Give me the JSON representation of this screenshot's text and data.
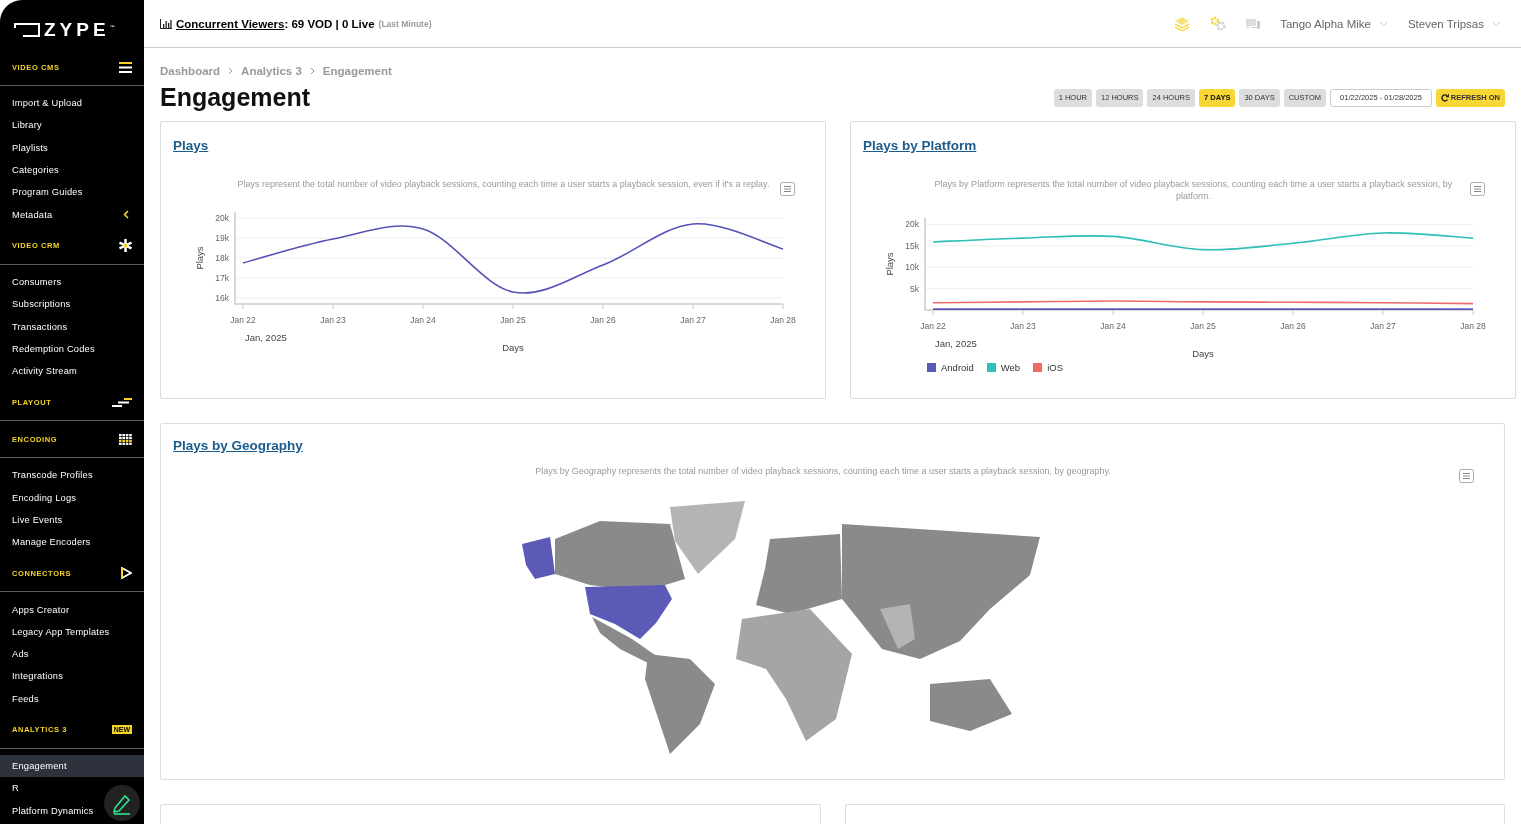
{
  "sidebar": {
    "logo": "ZYPE$^{™}$",
    "sections": [
      {
        "title": "VIDEO CMS",
        "kind": "menu",
        "items": [
          {
            "label": "Import & Upload",
            "selected": false
          },
          {
            "label": "Library",
            "selected": false
          },
          {
            "label": "Playlists",
            "selected": false
          },
          {
            "label": "Categories",
            "selected": false
          },
          {
            "label": "Program Guides",
            "selected": false
          },
          {
            "label": "Metadata",
            "selected": false,
            "has_submenu": true
          }
        ]
      },
      {
        "title": "VIDEO CRM",
        "kind": "asterisk",
        "items": [
          {
            "label": "Consumers",
            "selected": false
          },
          {
            "label": "Subscriptions",
            "selected": false
          },
          {
            "label": "Transactions",
            "selected": false
          },
          {
            "label": "Redemption Codes",
            "selected": false
          },
          {
            "label": "Activity Stream",
            "selected": false
          }
        ]
      },
      {
        "title": "PLAYOUT",
        "kind": "steps"
      },
      {
        "title": "ENCODING",
        "kind": "grid",
        "items": [
          {
            "label": "Transcode Profiles",
            "selected": false
          },
          {
            "label": "Encoding Logs",
            "selected": false
          },
          {
            "label": "Live Events",
            "selected": false
          },
          {
            "label": "Manage Encoders",
            "selected": false
          }
        ]
      },
      {
        "title": "CONNECTORS",
        "kind": "play",
        "items": [
          {
            "label": "Apps Creator",
            "selected": false
          },
          {
            "label": "Legacy App Templates",
            "selected": false
          },
          {
            "label": "Ads",
            "selected": false
          },
          {
            "label": "Integrations",
            "selected": false
          },
          {
            "label": "Feeds",
            "selected": false
          }
        ]
      },
      {
        "title": "ANALYTICS 3",
        "kind": "badge",
        "badge": "NEW",
        "items": [
          {
            "label": "Engagement",
            "selected": true
          },
          {
            "label": "R",
            "selected": false
          },
          {
            "label": "Platform Dynamics",
            "selected": false
          }
        ]
      }
    ]
  },
  "topbar": {
    "viewers_label": "Concurrent Viewers",
    "viewers_value": ": 69 VOD | 0 Live",
    "viewers_note": "(Last Minute)",
    "users": [
      "Tango Alpha Mike",
      "Steven Tripsas"
    ]
  },
  "breadcrumb": [
    "Dashboard",
    "Analytics 3",
    "Engagement"
  ],
  "title": "Engagement",
  "ranges": [
    {
      "label": "1 HOUR",
      "selected": false
    },
    {
      "label": "12 HOURS",
      "selected": false
    },
    {
      "label": "24 HOURS",
      "selected": false
    },
    {
      "label": "7 DAYS",
      "selected": true
    },
    {
      "label": "30 DAYS",
      "selected": false
    },
    {
      "label": "CUSTOM",
      "selected": false
    }
  ],
  "date_range": "01/22/2025 - 01/28/2025",
  "refresh": "REFRESH ON",
  "plays": {
    "title": "Plays",
    "description": "Plays represent the total number of video playback sessions, counting each time a user starts a playback session, even if it's a replay.",
    "period": "Jan, 2025",
    "chart_data": {
      "type": "line",
      "xlabel": "Days",
      "ylabel": "Plays",
      "categories": [
        "Jan 22",
        "Jan 23",
        "Jan 24",
        "Jan 25",
        "Jan 26",
        "Jan 27",
        "Jan 28"
      ],
      "ylim": [
        15700,
        20300
      ],
      "yticks": [
        {
          "value": 16000,
          "label": "16k"
        },
        {
          "value": 17000,
          "label": "17k"
        },
        {
          "value": 18000,
          "label": "18k"
        },
        {
          "value": 19000,
          "label": "19k"
        },
        {
          "value": 20000,
          "label": "20k"
        }
      ],
      "grid": true,
      "series": [
        {
          "color": "#5452b8",
          "values": [
            17750,
            18950,
            19450,
            16300,
            17650,
            19700,
            18450
          ]
        }
      ]
    }
  },
  "platform": {
    "title": "Plays by Platform",
    "description": "Plays by Platform represents the total number of video playback sessions, counting each time a user starts a playback session, by platform.",
    "period": "Jan, 2025",
    "chart_data": {
      "type": "line",
      "xlabel": "Days",
      "ylabel": "Plays",
      "categories": [
        "Jan 22",
        "Jan 23",
        "Jan 24",
        "Jan 25",
        "Jan 26",
        "Jan 27",
        "Jan 28"
      ],
      "ylim": [
        0,
        21500
      ],
      "yticks": [
        {
          "value": 5000,
          "label": "5k"
        },
        {
          "value": 10000,
          "label": "10k"
        },
        {
          "value": 15000,
          "label": "15k"
        },
        {
          "value": 20000,
          "label": "20k"
        }
      ],
      "grid": true,
      "legend": true,
      "series": [
        {
          "name": "Android",
          "color": "#5b5bb7",
          "values": [
            200,
            200,
            200,
            200,
            200,
            200,
            200
          ]
        },
        {
          "name": "Web",
          "color": "#2fbfb6",
          "values": [
            15900,
            16800,
            17200,
            14100,
            15600,
            18000,
            16800
          ]
        },
        {
          "name": "iOS",
          "color": "#ee6b68",
          "values": [
            1700,
            1900,
            2100,
            1900,
            1800,
            1700,
            1500
          ]
        }
      ]
    }
  },
  "geography": {
    "title": "Plays by Geography",
    "description": "Plays by Geography represents the total number of video playback sessions, counting each time a user starts a playback session, by geography."
  }
}
